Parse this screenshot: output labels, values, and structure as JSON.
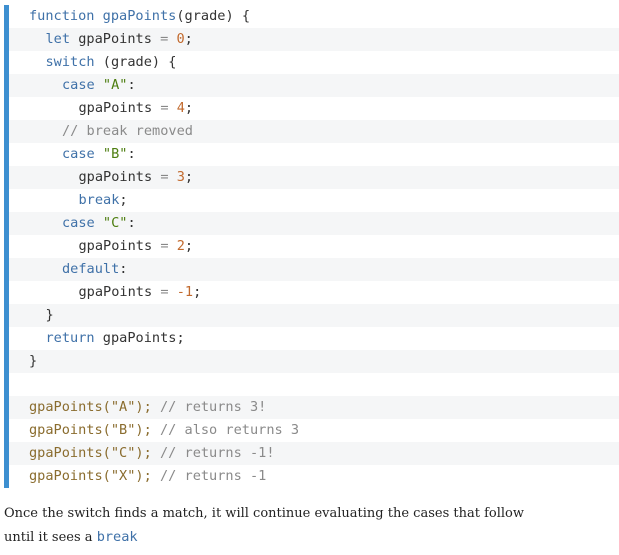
{
  "code": {
    "lines": [
      {
        "indent": 0,
        "tokens": [
          {
            "t": "kw",
            "v": "function "
          },
          {
            "t": "fn",
            "v": "gpaPoints"
          },
          {
            "t": "txt",
            "v": "(grade) {"
          }
        ]
      },
      {
        "indent": 1,
        "tokens": [
          {
            "t": "kw",
            "v": "let "
          },
          {
            "t": "txt",
            "v": "gpaPoints "
          },
          {
            "t": "op",
            "v": "= "
          },
          {
            "t": "num",
            "v": "0"
          },
          {
            "t": "txt",
            "v": ";"
          }
        ]
      },
      {
        "indent": 1,
        "tokens": [
          {
            "t": "kw",
            "v": "switch "
          },
          {
            "t": "txt",
            "v": "(grade) {"
          }
        ]
      },
      {
        "indent": 2,
        "tokens": [
          {
            "t": "kw",
            "v": "case "
          },
          {
            "t": "str",
            "v": "\"A\""
          },
          {
            "t": "txt",
            "v": ":"
          }
        ]
      },
      {
        "indent": 3,
        "tokens": [
          {
            "t": "txt",
            "v": "gpaPoints "
          },
          {
            "t": "op",
            "v": "= "
          },
          {
            "t": "num",
            "v": "4"
          },
          {
            "t": "txt",
            "v": ";"
          }
        ]
      },
      {
        "indent": 2,
        "tokens": [
          {
            "t": "com",
            "v": "// break removed"
          }
        ]
      },
      {
        "indent": 2,
        "tokens": [
          {
            "t": "kw",
            "v": "case "
          },
          {
            "t": "str",
            "v": "\"B\""
          },
          {
            "t": "txt",
            "v": ":"
          }
        ]
      },
      {
        "indent": 3,
        "tokens": [
          {
            "t": "txt",
            "v": "gpaPoints "
          },
          {
            "t": "op",
            "v": "= "
          },
          {
            "t": "num",
            "v": "3"
          },
          {
            "t": "txt",
            "v": ";"
          }
        ]
      },
      {
        "indent": 3,
        "tokens": [
          {
            "t": "kw",
            "v": "break"
          },
          {
            "t": "txt",
            "v": ";"
          }
        ]
      },
      {
        "indent": 2,
        "tokens": [
          {
            "t": "kw",
            "v": "case "
          },
          {
            "t": "str",
            "v": "\"C\""
          },
          {
            "t": "txt",
            "v": ":"
          }
        ]
      },
      {
        "indent": 3,
        "tokens": [
          {
            "t": "txt",
            "v": "gpaPoints "
          },
          {
            "t": "op",
            "v": "= "
          },
          {
            "t": "num",
            "v": "2"
          },
          {
            "t": "txt",
            "v": ";"
          }
        ]
      },
      {
        "indent": 2,
        "tokens": [
          {
            "t": "kw",
            "v": "default"
          },
          {
            "t": "txt",
            "v": ":"
          }
        ]
      },
      {
        "indent": 3,
        "tokens": [
          {
            "t": "txt",
            "v": "gpaPoints "
          },
          {
            "t": "op",
            "v": "= "
          },
          {
            "t": "num",
            "v": "-1"
          },
          {
            "t": "txt",
            "v": ";"
          }
        ]
      },
      {
        "indent": 1,
        "tokens": [
          {
            "t": "txt",
            "v": "}"
          }
        ]
      },
      {
        "indent": 1,
        "tokens": [
          {
            "t": "kw",
            "v": "return "
          },
          {
            "t": "txt",
            "v": "gpaPoints;"
          }
        ]
      },
      {
        "indent": 0,
        "tokens": [
          {
            "t": "txt",
            "v": "}"
          }
        ]
      },
      {
        "indent": 0,
        "tokens": []
      },
      {
        "indent": 0,
        "tokens": [
          {
            "t": "strB",
            "v": "gpaPoints(\"A\"); "
          },
          {
            "t": "com",
            "v": "// returns 3!"
          }
        ]
      },
      {
        "indent": 0,
        "tokens": [
          {
            "t": "strB",
            "v": "gpaPoints(\"B\"); "
          },
          {
            "t": "com",
            "v": "// also returns 3"
          }
        ]
      },
      {
        "indent": 0,
        "tokens": [
          {
            "t": "strB",
            "v": "gpaPoints(\"C\"); "
          },
          {
            "t": "com",
            "v": "// returns -1!"
          }
        ]
      },
      {
        "indent": 0,
        "tokens": [
          {
            "t": "strB",
            "v": "gpaPoints(\"X\"); "
          },
          {
            "t": "com",
            "v": "// returns -1"
          }
        ]
      }
    ]
  },
  "prose": {
    "line1": "Once the switch finds a match, it will continue evaluating the cases that follow",
    "line2_prefix": "until it sees a ",
    "line2_code": "break"
  },
  "colors": {
    "accent_bar": "#3d8fd0",
    "keyword": "#3f71a8",
    "string": "#4d7e10",
    "number": "#c26a2e",
    "comment": "#8a8a8a"
  }
}
